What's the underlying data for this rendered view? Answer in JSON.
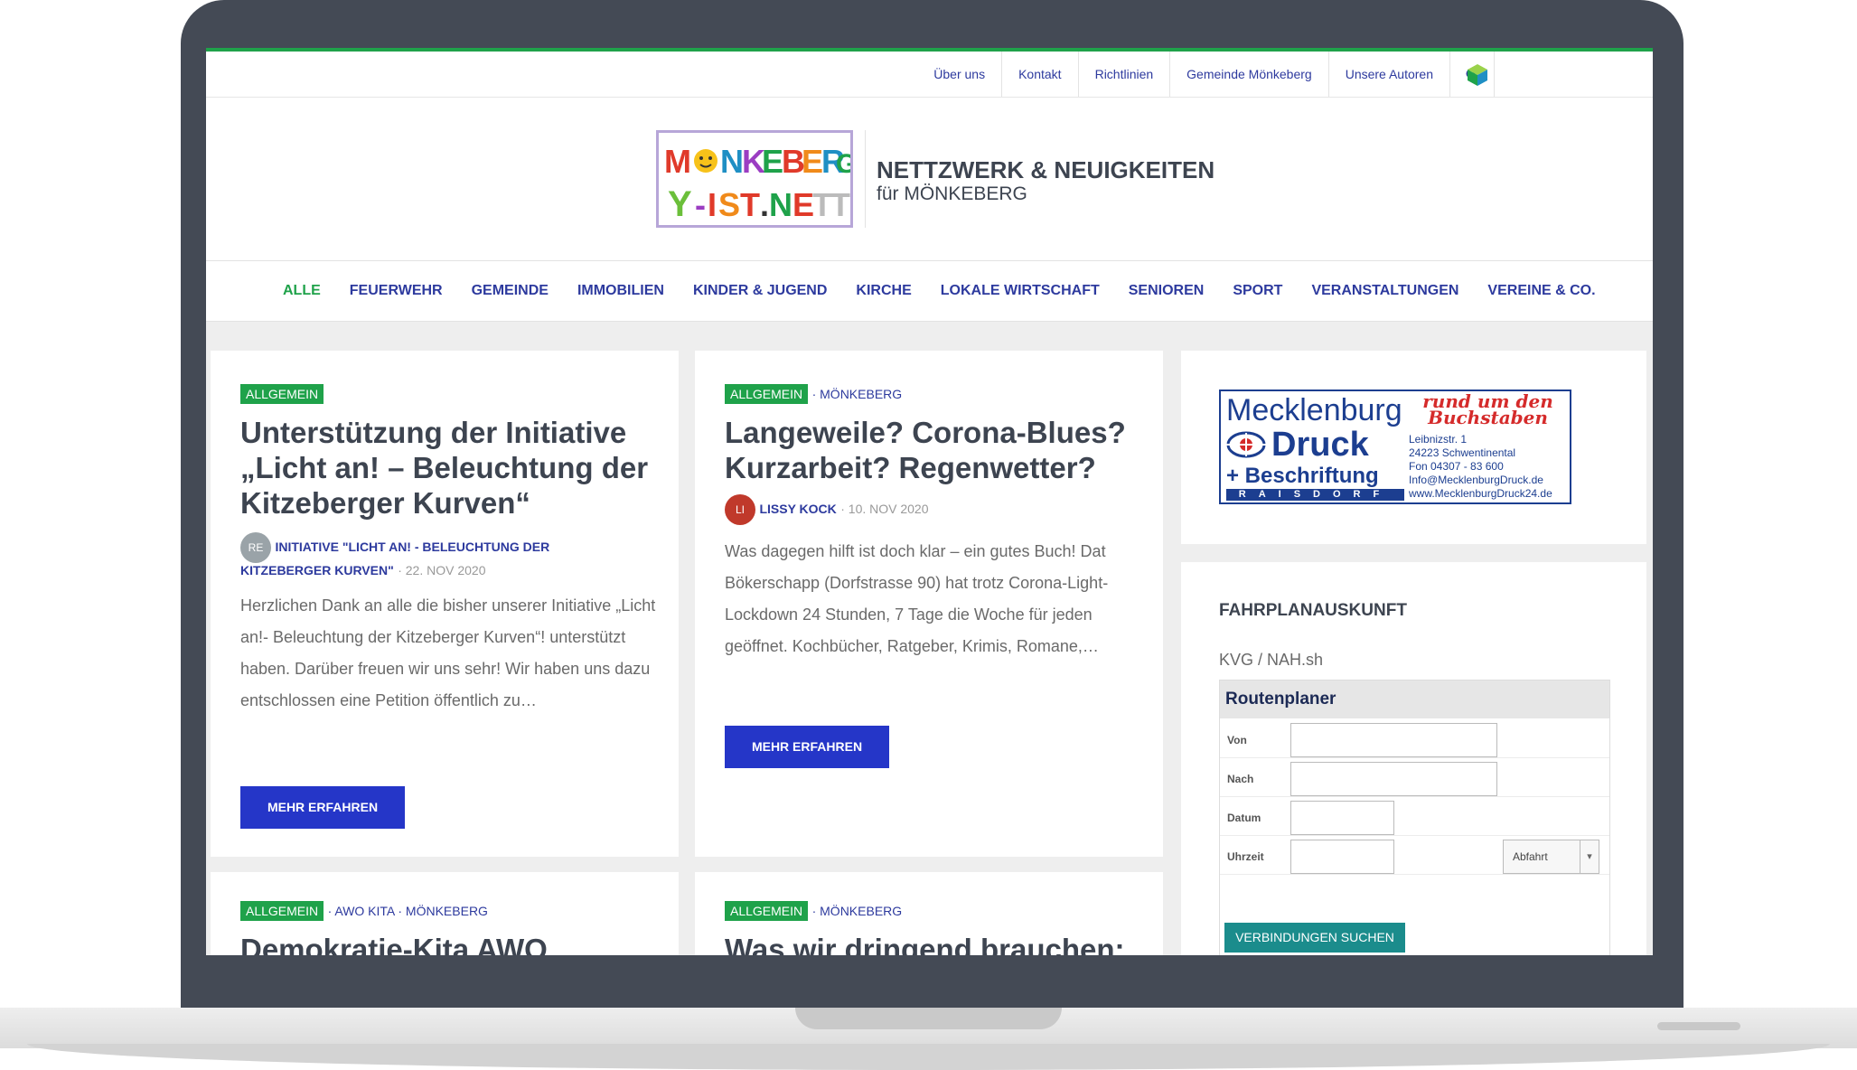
{
  "topnav": {
    "items": [
      "Über uns",
      "Kontakt",
      "Richtlinien",
      "Gemeinde Mönkeberg",
      "Unsere Autoren"
    ],
    "search_icon": "search-icon",
    "extra_icon": "cube-icon"
  },
  "header": {
    "logo_text_line1": "MÖNKEBERG",
    "logo_text_line2": "-IST.NETT",
    "title": "NETTZWERK & NEUIGKEITEN",
    "tagline": "für MÖNKEBERG"
  },
  "catnav": {
    "items": [
      "ALLE",
      "FEUERWEHR",
      "GEMEINDE",
      "IMMOBILIEN",
      "KINDER & JUGEND",
      "KIRCHE",
      "LOKALE WIRTSCHAFT",
      "SENIOREN",
      "SPORT",
      "VERANSTALTUNGEN",
      "VEREINE & CO."
    ],
    "active": "ALLE"
  },
  "posts": [
    {
      "badge": "ALLGEMEIN",
      "cats": "",
      "title": "Unterstützung der Initiative „Licht an! – Beleuchtung der Kitzeberger Kurven“",
      "avatar": "RE",
      "author_line1": "INITIATIVE \"LICHT AN! - BELEUCHTUNG DER",
      "author_line2": "KITZEBERGER KURVEN\"",
      "date": "22. NOV 2020",
      "excerpt": "Herzlichen Dank an alle die bisher unserer Initiative „Licht an!- Beleuchtung der Kitzeberger Kurven“! unterstützt haben. Darüber freuen wir uns sehr! Wir haben uns dazu entschlossen eine Petition öffentlich zu…",
      "button": "MEHR ERFAHREN"
    },
    {
      "badge": "ALLGEMEIN",
      "cats": "· MÖNKEBERG",
      "title": "Langeweile? Corona-Blues? Kurzarbeit? Regenwetter?",
      "avatar": "LI",
      "author": "LISSY KOCK",
      "date": "10. NOV 2020",
      "excerpt": "Was dagegen hilft ist doch klar – ein gutes Buch! Dat Bökerschapp (Dorfstrasse 90) hat trotz Corona-Light-Lockdown 24 Stunden, 7 Tage die Woche für jeden geöffnet. Kochbücher, Ratgeber, Krimis, Romane,…",
      "button": "MEHR ERFAHREN"
    },
    {
      "badge": "ALLGEMEIN",
      "cats": "· AWO KITA · MÖNKEBERG",
      "title": "Demokratie-Kita AWO"
    },
    {
      "badge": "ALLGEMEIN",
      "cats": "· MÖNKEBERG",
      "title": "Was wir dringend brauchen:"
    }
  ],
  "ad": {
    "line1": "Mecklenburg",
    "line2": "Druck",
    "line3": "+ Beschriftung",
    "line4": "RAISDORF",
    "slogan": "rund um den Buchstaben",
    "address": [
      "Leibnizstr. 1",
      "24223 Schwentinental",
      "Fon 04307 - 83 600",
      "Info@MecklenburgDruck.de",
      "www.MecklenburgDruck24.de"
    ]
  },
  "widget": {
    "title": "FAHRPLANAUSKUNFT",
    "provider": "KVG / NAH.sh",
    "planner_title": "Routenplaner",
    "labels": {
      "from": "Von",
      "to": "Nach",
      "date": "Datum",
      "time": "Uhrzeit"
    },
    "select_value": "Abfahrt",
    "button": "VERBINDUNGEN SUCHEN"
  },
  "colors": {
    "accent_green": "#1fa24a",
    "link_blue": "#2d3a9e",
    "button_blue": "#2536c8",
    "frame": "#444a55"
  }
}
